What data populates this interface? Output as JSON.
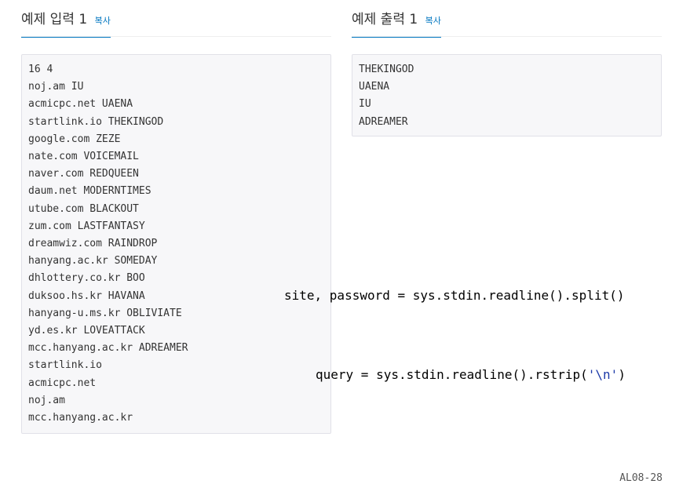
{
  "input": {
    "title": "예제 입력 1",
    "copy_label": "복사",
    "lines": [
      "16 4",
      "noj.am IU",
      "acmicpc.net UAENA",
      "startlink.io THEKINGOD",
      "google.com ZEZE",
      "nate.com VOICEMAIL",
      "naver.com REDQUEEN",
      "daum.net MODERNTIMES",
      "utube.com BLACKOUT",
      "zum.com LASTFANTASY",
      "dreamwiz.com RAINDROP",
      "hanyang.ac.kr SOMEDAY",
      "dhlottery.co.kr BOO",
      "duksoo.hs.kr HAVANA",
      "hanyang-u.ms.kr OBLIVIATE",
      "yd.es.kr LOVEATTACK",
      "mcc.hanyang.ac.kr ADREAMER",
      "startlink.io",
      "acmicpc.net",
      "noj.am",
      "mcc.hanyang.ac.kr"
    ]
  },
  "output": {
    "title": "예제 출력 1",
    "copy_label": "복사",
    "lines": [
      "THEKINGOD",
      "UAENA",
      "IU",
      "ADREAMER"
    ]
  },
  "code": {
    "line1": "site, password = sys.stdin.readline().split()",
    "line2_prefix": "query = sys.stdin.readline().rstrip(",
    "line2_string": "'\\n'",
    "line2_suffix": ")"
  },
  "page_id": "AL08-28"
}
